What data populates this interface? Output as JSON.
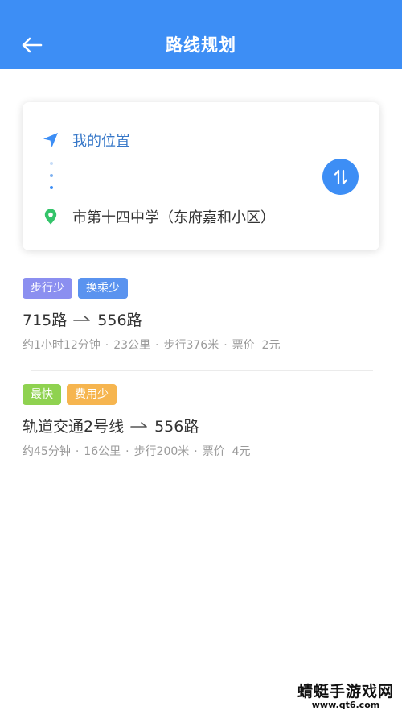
{
  "header": {
    "title": "路线规划",
    "back_icon": "back-arrow-icon",
    "background": "#3d8ef5"
  },
  "route_input": {
    "from_label": "我的位置",
    "to_label": "市第十四中学（东府嘉和小区）",
    "from_icon": "navigation-arrow-icon",
    "to_icon": "location-pin-icon",
    "swap_icon": "swap-arrows-icon"
  },
  "options": [
    {
      "tags": [
        {
          "label": "步行少",
          "color": "#8b8ff0"
        },
        {
          "label": "换乘少",
          "color": "#5a93ef"
        }
      ],
      "segments": [
        "715路",
        "556路"
      ],
      "meta": {
        "duration": "约1小时12分钟",
        "distance": "23公里",
        "walk": "步行376米",
        "fare": "票价  2元"
      }
    },
    {
      "tags": [
        {
          "label": "最快",
          "color": "#8fd250"
        },
        {
          "label": "费用少",
          "color": "#f6b54f"
        }
      ],
      "segments": [
        "轨道交通2号线",
        "556路"
      ],
      "meta": {
        "duration": "约45分钟",
        "distance": "16公里",
        "walk": "步行200米",
        "fare": "票价  4元"
      }
    }
  ],
  "separator": "·",
  "watermark": {
    "main": "蜻蜓手游戏网",
    "sub": "www.qt6.com"
  }
}
